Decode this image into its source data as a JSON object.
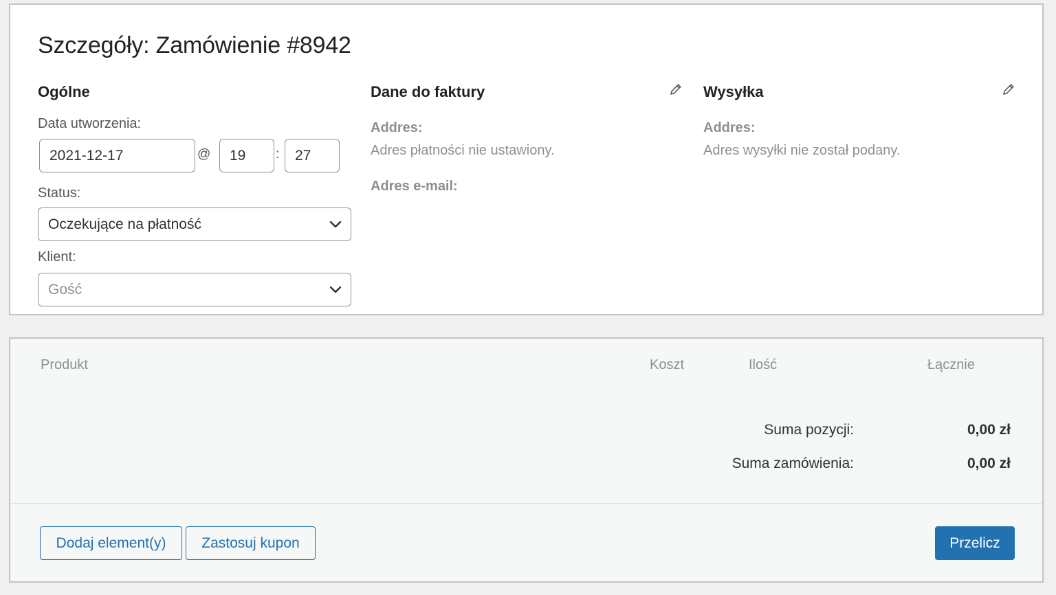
{
  "order": {
    "title": "Szczegóły: Zamówienie #8942",
    "general": {
      "heading": "Ogólne",
      "date_label": "Data utworzenia:",
      "date_value": "2021-12-17",
      "at_sign": "@",
      "hour_value": "19",
      "colon": ":",
      "minute_value": "27",
      "status_label": "Status:",
      "status_value": "Oczekujące na płatność",
      "customer_label": "Klient:",
      "customer_value": "Gość"
    },
    "billing": {
      "heading": "Dane do faktury",
      "address_label": "Addres:",
      "address_value": "Adres płatności nie ustawiony.",
      "email_label": "Adres e-mail:"
    },
    "shipping": {
      "heading": "Wysyłka",
      "address_label": "Addres:",
      "address_value": "Adres wysyłki nie został podany."
    }
  },
  "items": {
    "columns": {
      "product": "Produkt",
      "cost": "Koszt",
      "qty": "Ilość",
      "total": "Łącznie"
    },
    "totals": {
      "subtotal_label": "Suma pozycji:",
      "subtotal_value": "0,00 zł",
      "order_total_label": "Suma zamówienia:",
      "order_total_value": "0,00 zł"
    },
    "buttons": {
      "add_items": "Dodaj element(y)",
      "apply_coupon": "Zastosuj kupon",
      "recalculate": "Przelicz"
    }
  },
  "icons": {
    "pencil": "pencil-icon",
    "chevron": "chevron-down-icon"
  },
  "colors": {
    "accent": "#2271b1",
    "muted_text": "#8c8f94",
    "panel_border": "#c3c4c7",
    "page_bg": "#f0f0f1"
  }
}
